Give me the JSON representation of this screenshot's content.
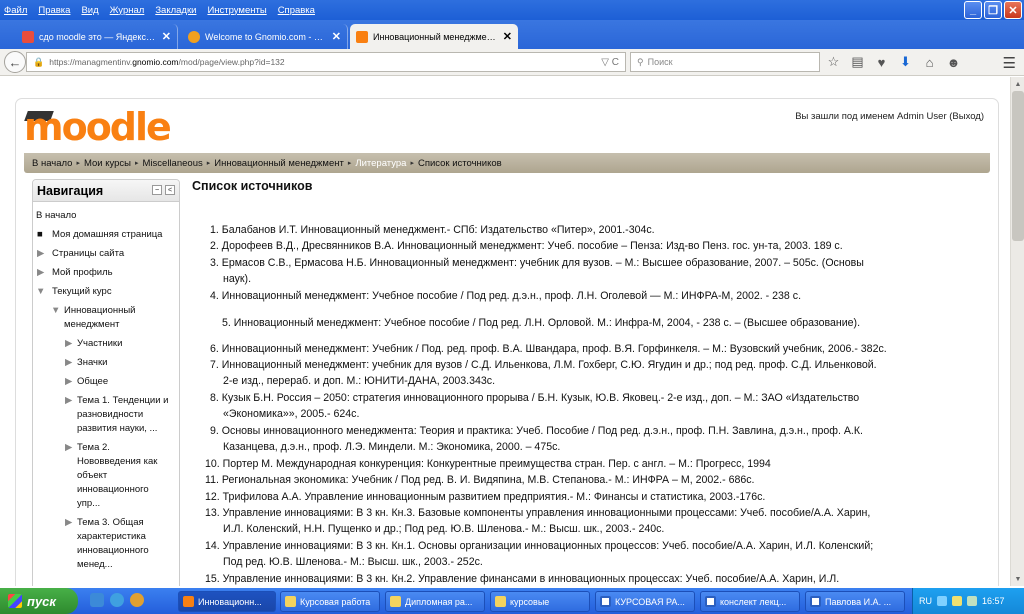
{
  "browser": {
    "menu": [
      "Файл",
      "Правка",
      "Вид",
      "Журнал",
      "Закладки",
      "Инструменты",
      "Справка"
    ],
    "tabs": [
      {
        "title": "сдо moodle это — Яндекс: н...",
        "fav_color": "#e84d3d"
      },
      {
        "title": "Welcome to Gnomio.com - na...",
        "fav_color": "#f0a020"
      },
      {
        "title": "Инновационный менеджмен...",
        "fav_color": "#f98012"
      }
    ],
    "new_tab": "+",
    "close_tab": "✕",
    "url_prefix": "https://managmentinv.",
    "url_domain": "gnomio.com",
    "url_path": "/mod/page/view.php?id=132",
    "url_tools": "▽ C",
    "search_placeholder": "Поиск"
  },
  "moodle": {
    "logo": "moodle",
    "login_text": "Вы зашли под именем Admin User (Выход)",
    "breadcrumb": [
      "В начало",
      "Мои курсы",
      "Miscellaneous",
      "Инновационный менеджмент",
      "Литература",
      "Список источников"
    ]
  },
  "nav": {
    "title": "Навигация",
    "items": [
      "В начало",
      "Моя домашняя страница",
      "Страницы сайта",
      "Мой профиль",
      "Текущий курс",
      "Инновационный",
      "менеджмент",
      "Участники",
      "Значки",
      "Общее",
      "Тема 1. Тенденции и",
      "разновидности",
      "развития науки, ...",
      "Тема 2.",
      "Нововведения как",
      "объект",
      "инновационного",
      "упр...",
      "Тема 3. Общая",
      "характеристика",
      "инновационного",
      "менед..."
    ]
  },
  "content": {
    "title": "Список источников",
    "refs": [
      "1.  Балабанов И.Т. Инновационный менеджмент.- СПб: Издательство «Питер», 2001.-304с.",
      "2.  Дорофеев В.Д., Дресвянников В.А. Инновационный менеджмент: Учеб. пособие – Пенза: Изд-во Пенз. гос. ун-та, 2003. 189 с.",
      "3.  Ермасов С.В., Ермасова Н.Б. Инновационный менеджмент: учебник для вузов. – М.: Высшее образование, 2007. – 505с. (Основы",
      "наук).",
      "4.  Инновационный менеджмент: Учебное пособие / Под ред. д.э.н., проф. Л.Н. Оголевой — М.: ИНФРА-М, 2002. - 238 с.",
      "5.   Инновационный менеджмент: Учебное пособие / Под ред. Л.Н. Орловой. М.: Инфра-М, 2004, - 238 с. – (Высшее образование).",
      "6.  Инновационный менеджмент: Учебник / Под. ред. проф. В.А. Швандара, проф. В.Я. Горфинкеля. – М.: Вузовский учебник, 2006.- 382с.",
      "7.  Инновационный менеджмент: учебник для вузов / С.Д. Ильенкова, Л.М. Гохберг, С.Ю. Ягудин и др.; под ред. проф. С.Д. Ильенковой.",
      "2-е изд., перераб. и доп. М.: ЮНИТИ-ДАНА, 2003.343с.",
      "8.  Кузык Б.Н. Россия – 2050: стратегия инновационного прорыва / Б.Н. Кузык, Ю.В. Яковец.- 2-е изд., доп. – М.: ЗАО «Издательство",
      "«Экономика»», 2005.- 624с.",
      "9.  Основы инновационного менеджмента: Теория и практика: Учеб. Пособие / Под ред. д.э.н., проф. П.Н. Завлина, д.э.н., проф. А.К.",
      "Казанцева, д.э.н., проф. Л.Э. Миндели. М.: Экономика, 2000. – 475с.",
      "10.  Портер М. Международная конкуренция: Конкурентные преимущества стран. Пер. с англ. – М.: Прогресс, 1994",
      "11.  Региональная экономика: Учебник / Под ред. В. И. Видяпина, М.В. Степанова.- М.: ИНФРА – М, 2002.- 686с.",
      "12.  Трифилова А.А. Управление инновационным развитием предприятия.- М.: Финансы и статистика, 2003.-176с.",
      "13.  Управление инновациями: В 3 кн. Кн.3. Базовые компоненты управления инновационными процессами: Учеб. пособие/А.А. Харин,",
      "И.Л. Коленский, Н.Н. Пущенко и др.; Под ред. Ю.В. Шленова.- М.: Высш. шк., 2003.- 240с.",
      "14.  Управление инновациями: В 3 кн. Кн.1. Основы организации инновационных процессов: Учеб. пособие/А.А. Харин, И.Л. Коленский;",
      "Под ред. Ю.В. Шленова.- М.: Высш. шк., 2003.- 252с.",
      "15.  Управление инновациями: В 3 кн. Кн.2. Управление финансами в инновационных процессах: Учеб. пособие/А.А. Харин, И.Л."
    ]
  },
  "taskbar": {
    "start": "пуск",
    "buttons": [
      {
        "label": "Инновационн...",
        "color": "#f98012"
      },
      {
        "label": "Курсовая работа",
        "color": "#f4d35e"
      },
      {
        "label": "Дипломная ра...",
        "color": "#f4d35e"
      },
      {
        "label": "курсовые",
        "color": "#f4d35e"
      },
      {
        "label": "КУРСОВАЯ РА...",
        "color": "#2b5fc0"
      },
      {
        "label": "конслект лекц...",
        "color": "#2b5fc0"
      },
      {
        "label": "Павлова И.А. ...",
        "color": "#2b5fc0"
      }
    ],
    "lang": "RU",
    "time": "16:57"
  }
}
